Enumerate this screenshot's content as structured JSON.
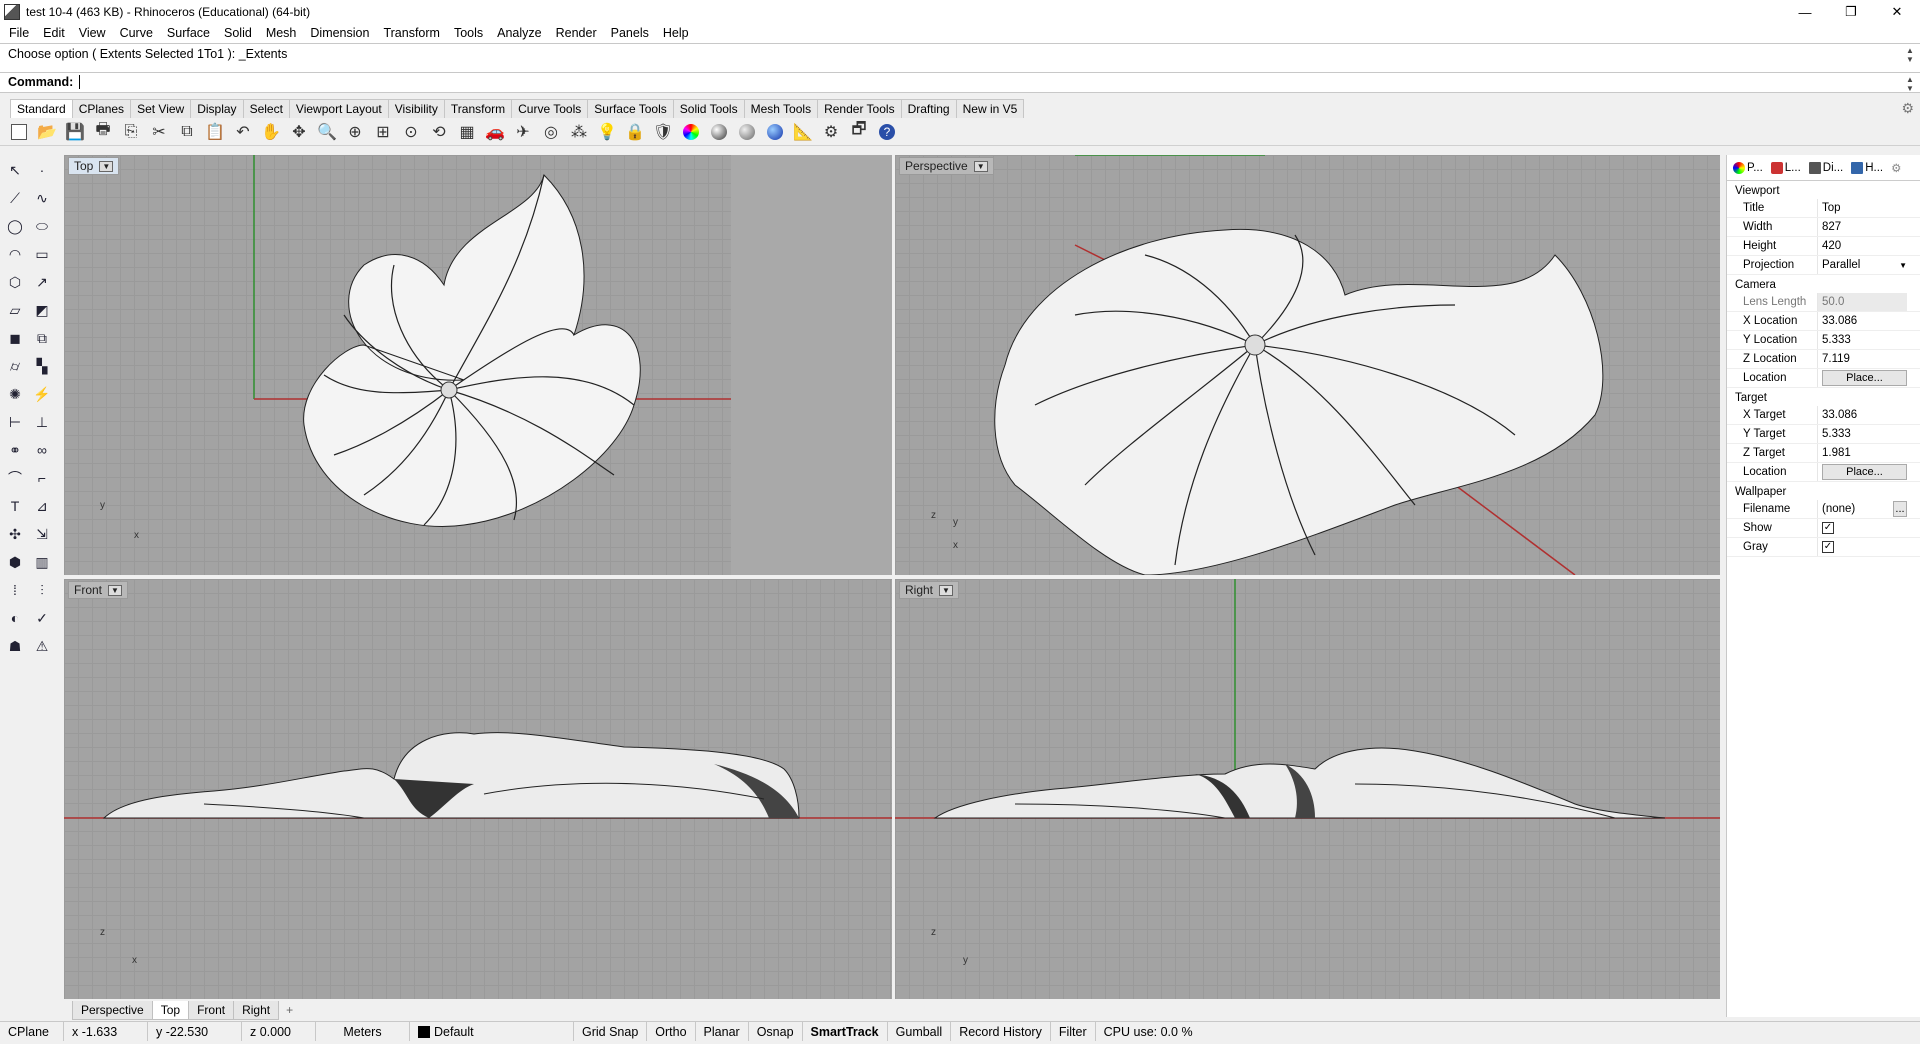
{
  "window": {
    "title": "test 10-4 (463 KB) - Rhinoceros (Educational) (64-bit)",
    "min": "—",
    "max": "❐",
    "close": "✕"
  },
  "menu": [
    "File",
    "Edit",
    "View",
    "Curve",
    "Surface",
    "Solid",
    "Mesh",
    "Dimension",
    "Transform",
    "Tools",
    "Analyze",
    "Render",
    "Panels",
    "Help"
  ],
  "command": {
    "history": "Choose option ( Extents  Selected  1To1 ): _Extents",
    "prompt": "Command:"
  },
  "toolbar_tabs": [
    "Standard",
    "CPlanes",
    "Set View",
    "Display",
    "Select",
    "Viewport Layout",
    "Visibility",
    "Transform",
    "Curve Tools",
    "Surface Tools",
    "Solid Tools",
    "Mesh Tools",
    "Render Tools",
    "Drafting",
    "New in V5"
  ],
  "viewports": {
    "top": "Top",
    "perspective": "Perspective",
    "front": "Front",
    "right": "Right"
  },
  "axes": {
    "x": "x",
    "y": "y",
    "z": "z"
  },
  "viewport_tabs": [
    "Perspective",
    "Top",
    "Front",
    "Right"
  ],
  "viewport_tab_add": "+",
  "status": {
    "cplane": "CPlane",
    "x": "x -1.633",
    "y": "y -22.530",
    "z": "z 0.000",
    "units": "Meters",
    "layer": "Default",
    "grid_snap": "Grid Snap",
    "ortho": "Ortho",
    "planar": "Planar",
    "osnap": "Osnap",
    "smarttrack": "SmartTrack",
    "gumball": "Gumball",
    "record_history": "Record History",
    "filter": "Filter",
    "cpu": "CPU use: 0.0 %"
  },
  "panel": {
    "tabs": [
      "P...",
      "L...",
      "Di...",
      "H..."
    ],
    "viewport_section": "Viewport",
    "viewport_props": [
      {
        "k": "Title",
        "v": "Top"
      },
      {
        "k": "Width",
        "v": "827"
      },
      {
        "k": "Height",
        "v": "420"
      },
      {
        "k": "Projection",
        "v": "Parallel"
      }
    ],
    "camera_section": "Camera",
    "camera_props": [
      {
        "k": "Lens Length",
        "v": "50.0"
      },
      {
        "k": "X Location",
        "v": "33.086"
      },
      {
        "k": "Y Location",
        "v": "5.333"
      },
      {
        "k": "Z Location",
        "v": "7.119"
      },
      {
        "k": "Location",
        "v": "Place..."
      }
    ],
    "target_section": "Target",
    "target_props": [
      {
        "k": "X Target",
        "v": "33.086"
      },
      {
        "k": "Y Target",
        "v": "5.333"
      },
      {
        "k": "Z Target",
        "v": "1.981"
      },
      {
        "k": "Location",
        "v": "Place..."
      }
    ],
    "wallpaper_section": "Wallpaper",
    "wallpaper_props": [
      {
        "k": "Filename",
        "v": "(none)"
      },
      {
        "k": "Show",
        "v": "✓"
      },
      {
        "k": "Gray",
        "v": "✓"
      }
    ],
    "more": "..."
  },
  "colors": {
    "accent": "#3a6ea5",
    "grid_bg": "#a3a3a3",
    "x_axis": "#b03030",
    "y_axis": "#2f8f2f"
  }
}
